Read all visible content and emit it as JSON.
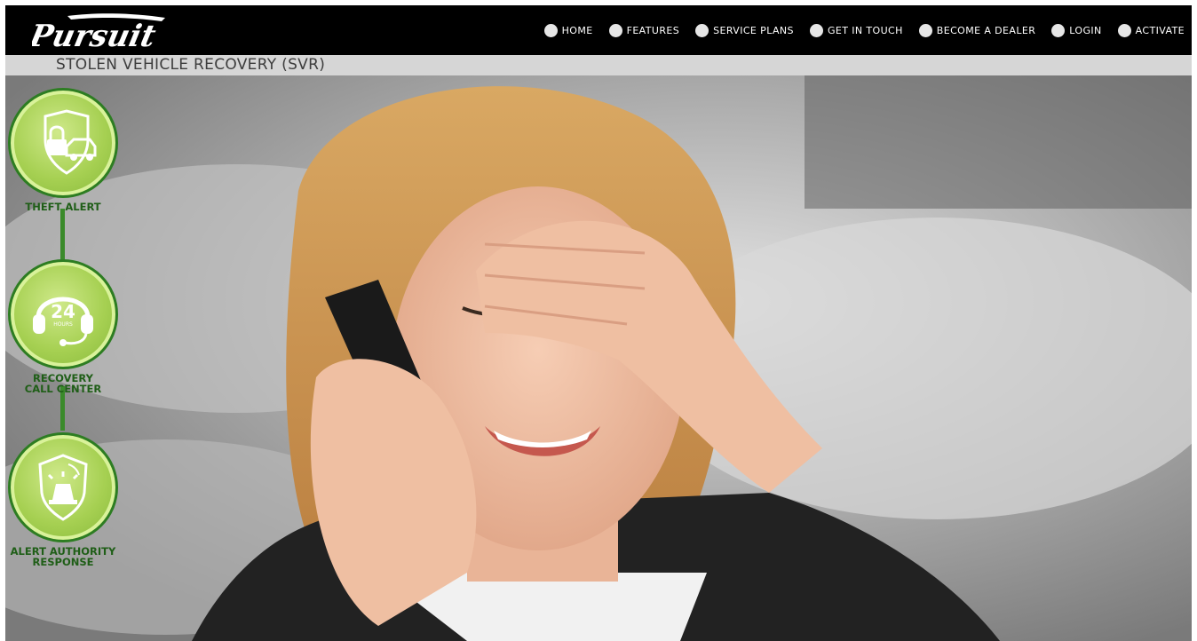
{
  "brand": {
    "logo_text": "Pursuit"
  },
  "nav": {
    "items": [
      {
        "label": "HOME"
      },
      {
        "label": "FEATURES"
      },
      {
        "label": "SERVICE PLANS"
      },
      {
        "label": "GET IN TOUCH"
      },
      {
        "label": "BECOME A DEALER"
      },
      {
        "label": "LOGIN"
      },
      {
        "label": "ACTIVATE"
      }
    ]
  },
  "page": {
    "title": "STOLEN VEHICLE RECOVERY (SVR)"
  },
  "steps": [
    {
      "label_line1": "THEFT ALERT",
      "label_line2": "",
      "icon": "lock-car-icon"
    },
    {
      "label_line1": "RECOVERY",
      "label_line2": "CALL CENTER",
      "icon": "headset-24-icon",
      "icon_text_big": "24",
      "icon_text_small": "HOURS"
    },
    {
      "label_line1": "ALERT AUTHORITY",
      "label_line2": "RESPONSE",
      "icon": "police-siren-icon"
    }
  ],
  "colors": {
    "topbar": "#000000",
    "titlebar": "#d6d6d6",
    "badge_green": "#a6d052",
    "badge_border": "#2d7d22",
    "step_text": "#1f5e17"
  }
}
